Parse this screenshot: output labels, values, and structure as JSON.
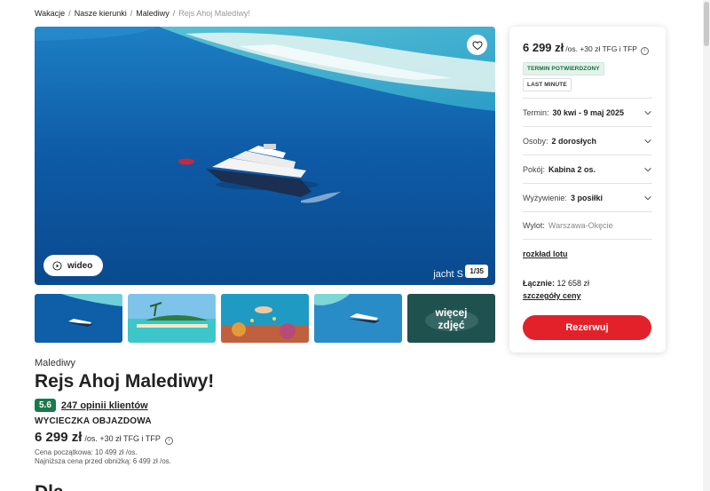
{
  "breadcrumb": [
    {
      "label": "Wakacje"
    },
    {
      "label": "Nasze kierunki"
    },
    {
      "label": "Malediwy"
    },
    {
      "label": "Rejs Ahoj Malediwy!"
    }
  ],
  "gallery": {
    "video_label": "wideo",
    "caption": "jacht S",
    "counter": "1/35",
    "more_photos": "więcej zdjęć",
    "icons": [
      "heart-icon",
      "play-icon"
    ]
  },
  "offer": {
    "region": "Malediwy",
    "title": "Rejs Ahoj Malediwy!",
    "rating": "5.6",
    "reviews": "247 opinii klientów",
    "trip_type": "WYCIECZKA OBJAZDOWA",
    "price": "6 299 zł",
    "price_suffix": "/os. +30 zł TFG i TFP",
    "price_start": "Cena początkowa: 10 499 zł /os.",
    "price_lowest": "Najniższa cena przed obniżką: 6 499 zł /os.",
    "next_heading": "Dla"
  },
  "booking": {
    "price": "6 299 zł",
    "price_suffix": "/os. +30 zł TFG i TFP",
    "tag_confirmed": "TERMIN POTWIERDZONY",
    "tag_last_minute": "LAST MINUTE",
    "rows": [
      {
        "label": "Termin:",
        "value": "30 kwi - 9 maj 2025"
      },
      {
        "label": "Osoby:",
        "value": "2 dorosłych"
      },
      {
        "label": "Pokój:",
        "value": "Kabina 2 os."
      },
      {
        "label": "Wyżywienie:",
        "value": "3 posiłki"
      },
      {
        "label": "Wylot:",
        "value": "Warszawa-Okęcie"
      }
    ],
    "flight_link": "rozkład lotu",
    "total_label": "Łącznie:",
    "total_value": "12 658 zł",
    "details_link": "szczegóły ceny",
    "reserve_label": "Rezerwuj"
  },
  "colors": {
    "accent_red": "#e3212b",
    "rating_green": "#1a7a4c",
    "tag_green_bg": "#e3f3ea"
  }
}
